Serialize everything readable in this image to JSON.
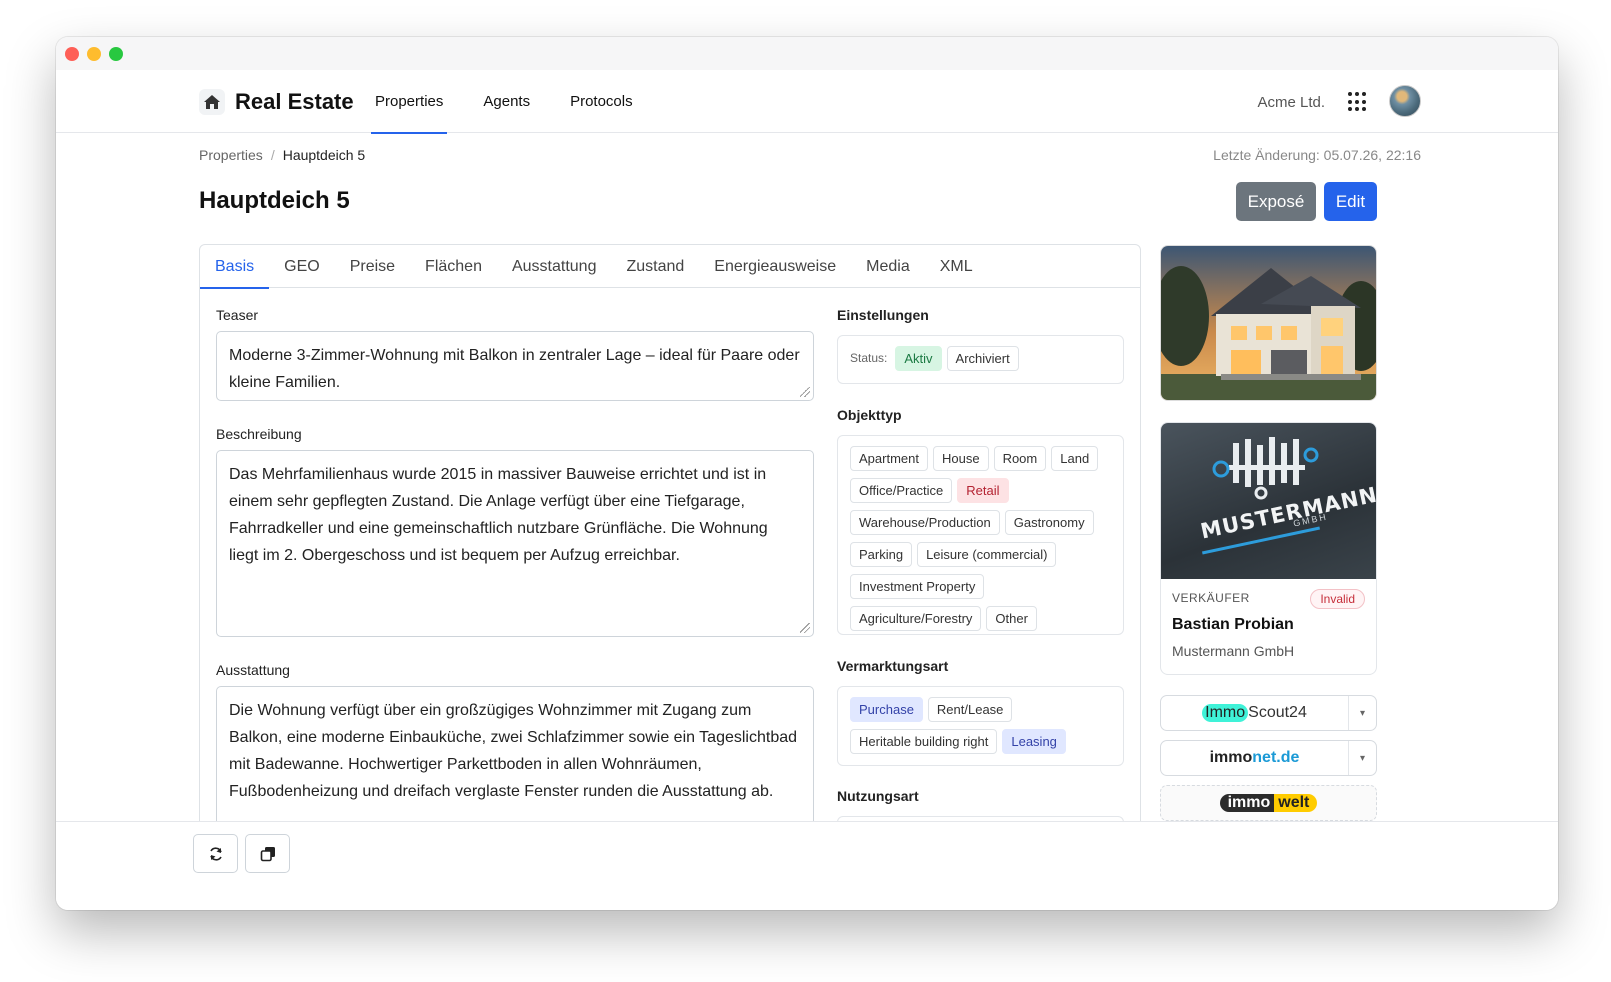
{
  "app": {
    "name": "Real Estate",
    "org": "Acme Ltd."
  },
  "nav": [
    "Properties",
    "Agents",
    "Protocols"
  ],
  "breadcrumb": {
    "parent": "Properties",
    "separator": "/",
    "current": "Hauptdeich 5"
  },
  "last_modified": "Letzte Änderung: 05.07.26, 22:16",
  "page": {
    "title": "Hauptdeich 5",
    "expose_label": "Exposé",
    "edit_label": "Edit"
  },
  "tabs": [
    "Basis",
    "GEO",
    "Preise",
    "Flächen",
    "Ausstattung",
    "Zustand",
    "Energieausweise",
    "Media",
    "XML"
  ],
  "fields": {
    "teaser": {
      "label": "Teaser",
      "value": "Moderne 3-Zimmer-Wohnung mit Balkon in zentraler Lage – ideal für Paare oder kleine Familien."
    },
    "beschreibung": {
      "label": "Beschreibung",
      "value": "Das Mehrfamilienhaus wurde 2015 in massiver Bauweise errichtet und ist in einem sehr gepflegten Zustand. Die Anlage verfügt über eine Tiefgarage, Fahrradkeller und eine gemeinschaftlich nutzbare Grünfläche. Die Wohnung liegt im 2. Obergeschoss und ist bequem per Aufzug erreichbar."
    },
    "ausstattung": {
      "label": "Ausstattung",
      "value": "Die Wohnung verfügt über ein großzügiges Wohnzimmer mit Zugang zum Balkon, eine moderne Einbauküche, zwei Schlafzimmer sowie ein Tageslichtbad mit Badewanne. Hochwertiger Parkettboden in allen Wohnräumen, Fußbodenheizung und dreifach verglaste Fenster runden die Ausstattung ab."
    }
  },
  "settings": {
    "label": "Einstellungen",
    "status_label": "Status:",
    "status_options": [
      "Aktiv",
      "Archiviert"
    ]
  },
  "objekttyp": {
    "label": "Objekttyp",
    "options": [
      "Apartment",
      "House",
      "Room",
      "Land",
      "Office/Practice",
      "Retail",
      "Warehouse/Production",
      "Gastronomy",
      "Parking",
      "Leisure (commercial)",
      "Investment Property",
      "Agriculture/Forestry",
      "Other"
    ]
  },
  "vermarktungsart": {
    "label": "Vermarktungsart",
    "options": [
      "Purchase",
      "Rent/Lease",
      "Heritable building right",
      "Leasing"
    ]
  },
  "nutzungsart": {
    "label": "Nutzungsart"
  },
  "seller": {
    "role": "VERKÄUFER",
    "badge": "Invalid",
    "name": "Bastian Probian",
    "company": "Mustermann GmbH",
    "logo_text": "MUSTERMANN",
    "logo_sub": "GMBH"
  },
  "portals": [
    {
      "name_a": "Immo",
      "name_b": "Scout24"
    },
    {
      "name_a": "immo",
      "name_b": "net.de"
    },
    {
      "name_a": "immo",
      "name_b": "welt"
    }
  ],
  "colors": {
    "accent": "#2563eb",
    "secondary": "#6c757d",
    "active_green": "#d7f5e3",
    "retail_red": "#fde2e4",
    "selected_blue": "#e0e7ff"
  }
}
